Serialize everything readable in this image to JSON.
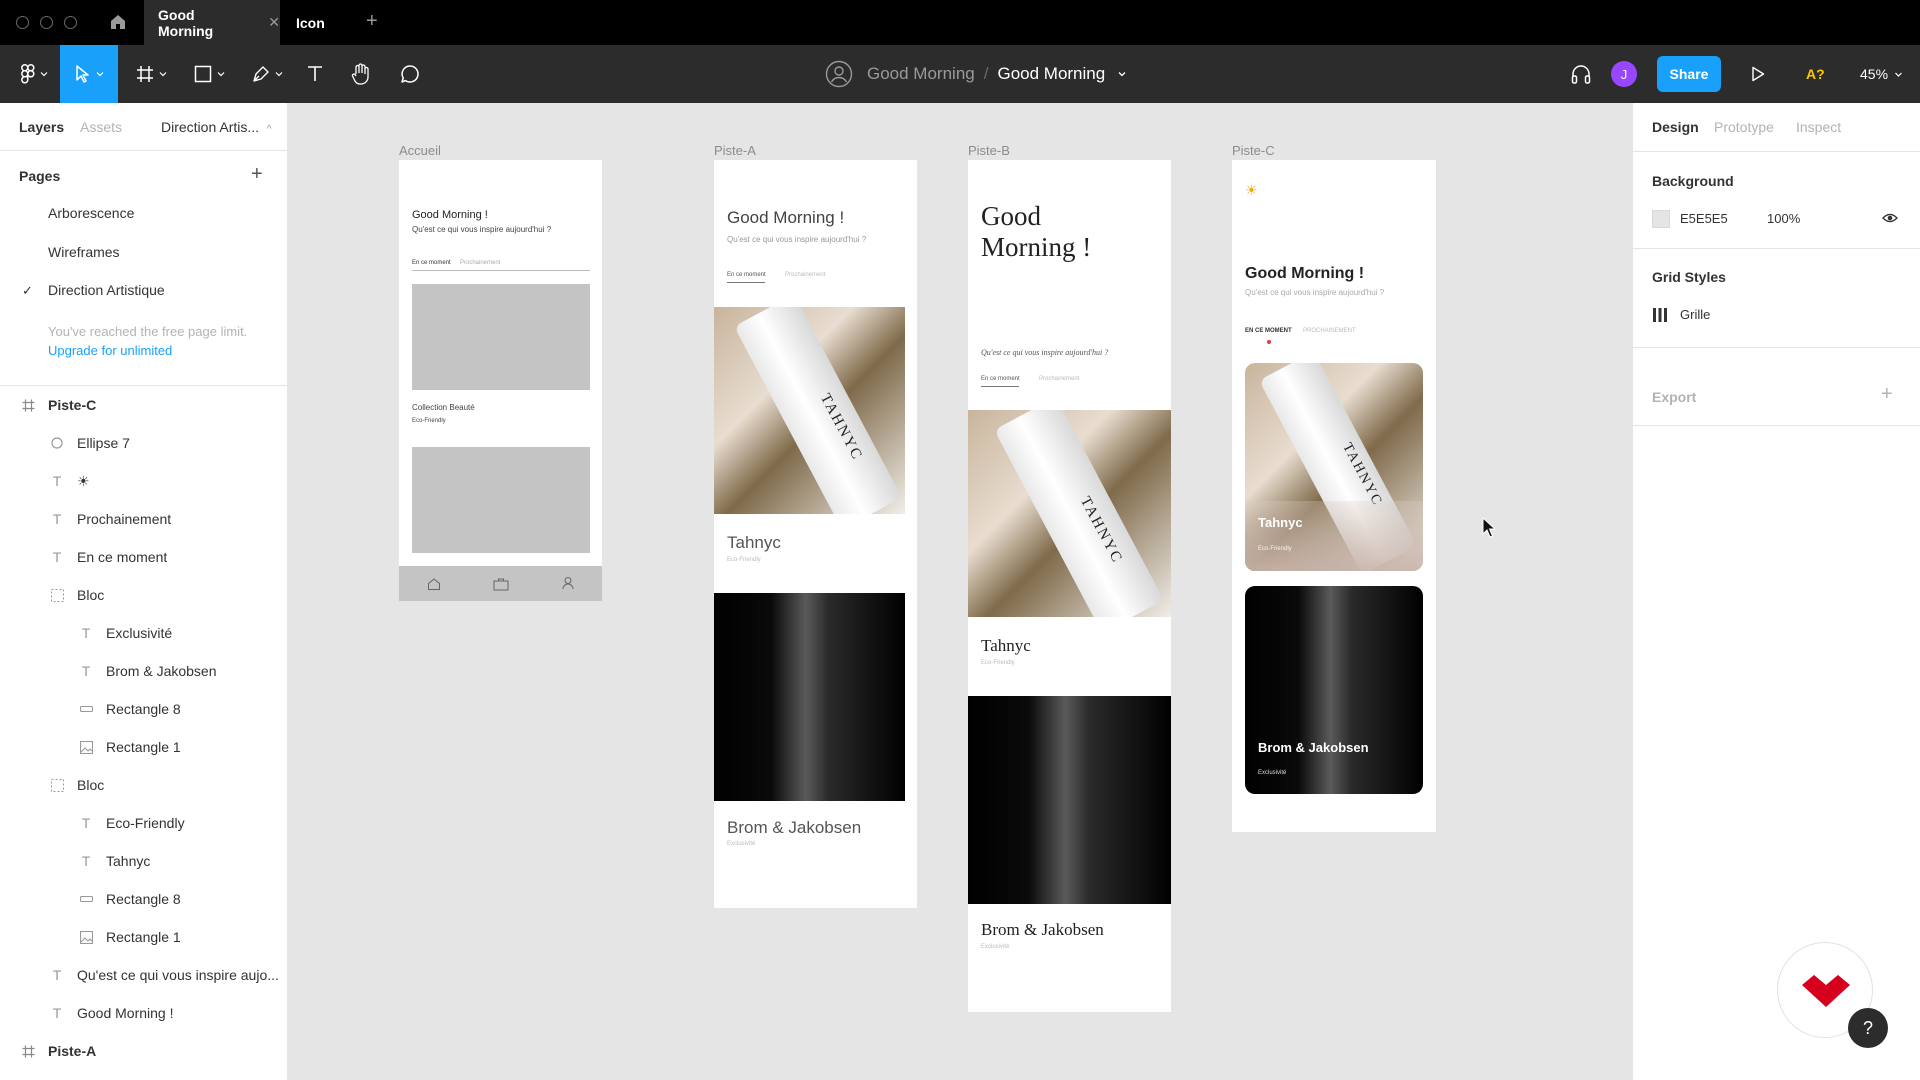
{
  "titlebar": {
    "tabs": [
      {
        "label": "Good Morning",
        "active": true
      },
      {
        "label": "Icon",
        "active": false
      }
    ]
  },
  "toolbar": {
    "breadcrumb": {
      "team": "Good Morning",
      "separator": "/",
      "file": "Good Morning"
    },
    "user_initial": "J",
    "share_label": "Share",
    "ai_label": "A?",
    "zoom_label": "45%"
  },
  "left_panel": {
    "tabs": [
      "Layers",
      "Assets"
    ],
    "current_page": "Direction Artis...",
    "pages_title": "Pages",
    "pages": [
      "Arborescence",
      "Wireframes",
      "Direction Artistique"
    ],
    "limit_text": "You've reached the free page limit.",
    "limit_link": "Upgrade for unlimited",
    "layers": [
      {
        "name": "Piste-C",
        "icon": "frame-icon"
      },
      {
        "name": "Ellipse 7",
        "icon": "ellipse-icon"
      },
      {
        "name": "☀",
        "icon": "text-icon"
      },
      {
        "name": "Prochainement",
        "icon": "text-icon"
      },
      {
        "name": "En ce moment",
        "icon": "text-icon"
      },
      {
        "name": "Bloc",
        "icon": "group-icon"
      },
      {
        "name": "Exclusivité",
        "icon": "text-icon"
      },
      {
        "name": "Brom & Jakobsen",
        "icon": "text-icon"
      },
      {
        "name": "Rectangle 8",
        "icon": "rectangle-icon"
      },
      {
        "name": "Rectangle 1",
        "icon": "image-icon"
      },
      {
        "name": "Bloc",
        "icon": "group-icon"
      },
      {
        "name": "Eco-Friendly",
        "icon": "text-icon"
      },
      {
        "name": "Tahnyc",
        "icon": "text-icon"
      },
      {
        "name": "Rectangle 8",
        "icon": "rectangle-icon"
      },
      {
        "name": "Rectangle 1",
        "icon": "image-icon"
      },
      {
        "name": "Qu'est ce qui vous inspire aujo...",
        "icon": "text-icon"
      },
      {
        "name": "Good Morning !",
        "icon": "text-icon"
      },
      {
        "name": "Piste-A",
        "icon": "frame-icon"
      }
    ]
  },
  "right_panel": {
    "tabs": [
      "Design",
      "Prototype",
      "Inspect"
    ],
    "background_title": "Background",
    "background_hex": "E5E5E5",
    "background_opacity": "100%",
    "grid_title": "Grid Styles",
    "grid_name": "Grille",
    "export_title": "Export"
  },
  "canvas": {
    "accueil": {
      "label": "Accueil",
      "title": "Good Morning !",
      "subtitle": "Qu'est ce qui vous inspire aujourd'hui ?",
      "tab_active": "En ce moment",
      "tab_inactive": "Prochainement",
      "collection": "Collection Beauté",
      "tag": "Eco-Friendly"
    },
    "piste_a": {
      "label": "Piste-A",
      "title": "Good Morning !",
      "subtitle": "Qu'est ce qui vous inspire aujourd'hui ?",
      "tab_active": "En ce moment",
      "tab_inactive": "Prochainement",
      "card1_title": "Tahnyc",
      "card1_tag": "Eco-Friendly",
      "card2_title": "Brom & Jakobsen",
      "card2_tag": "Exclusivité"
    },
    "piste_b": {
      "label": "Piste-B",
      "title_line1": "Good",
      "title_line2": "Morning !",
      "subtitle": "Qu'est ce qui vous inspire aujourd'hui ?",
      "tab_active": "En ce moment",
      "tab_inactive": "Prochainement",
      "card1_title": "Tahnyc",
      "card1_tag": "Eco-Friendly",
      "card2_title": "Brom & Jakobsen",
      "card2_tag": "Exclusivité"
    },
    "piste_c": {
      "label": "Piste-C",
      "sun": "☀",
      "title": "Good Morning !",
      "subtitle": "Qu'est ce qui vous inspire aujourd'hui ?",
      "tab_active": "EN CE MOMENT",
      "tab_inactive": "PROCHAINEMENT",
      "card1_title": "Tahnyc",
      "card1_tag": "Eco-Friendly",
      "card2_title": "Brom & Jakobsen",
      "card2_tag": "Exclusivité"
    },
    "product_brand": "TAHNYC"
  },
  "help_label": "?",
  "colors": {
    "accent": "#18a0fb",
    "avatar": "#9747ff",
    "toolbar_bg": "#2c2c2c",
    "titlebar_bg": "#000000",
    "logo_red": "#d6001c"
  }
}
